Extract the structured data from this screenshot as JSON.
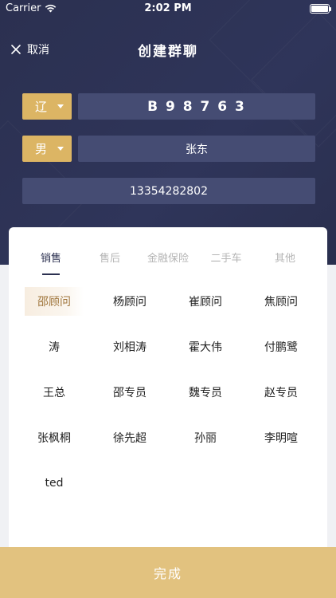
{
  "status_bar": {
    "carrier": "Carrier",
    "time": "2:02 PM"
  },
  "nav": {
    "cancel_label": "取消",
    "title": "创建群聊"
  },
  "form": {
    "region_value": "辽",
    "plate_value": "B 9 8 7 6 3",
    "gender_value": "男",
    "name_value": "张东",
    "phone_value": "13354282802"
  },
  "tabs": [
    {
      "label": "销售"
    },
    {
      "label": "售后"
    },
    {
      "label": "金融保险"
    },
    {
      "label": "二手车"
    },
    {
      "label": "其他"
    }
  ],
  "people": [
    "邵顾问",
    "杨顾问",
    "崔顾问",
    "焦顾问",
    "涛",
    "刘相涛",
    "霍大伟",
    "付鹏鹭",
    "王总",
    "邵专员",
    "魏专员",
    "赵专员",
    "张枫桐",
    "徐先超",
    "孙丽",
    "李明喧",
    "ted"
  ],
  "done_label": "完成",
  "colors": {
    "header_bg": "#2b3050",
    "field_bg": "#454c73",
    "accent_gold": "#dcb564",
    "done_bg": "#e2c27f",
    "selected_text": "#a0763c"
  }
}
